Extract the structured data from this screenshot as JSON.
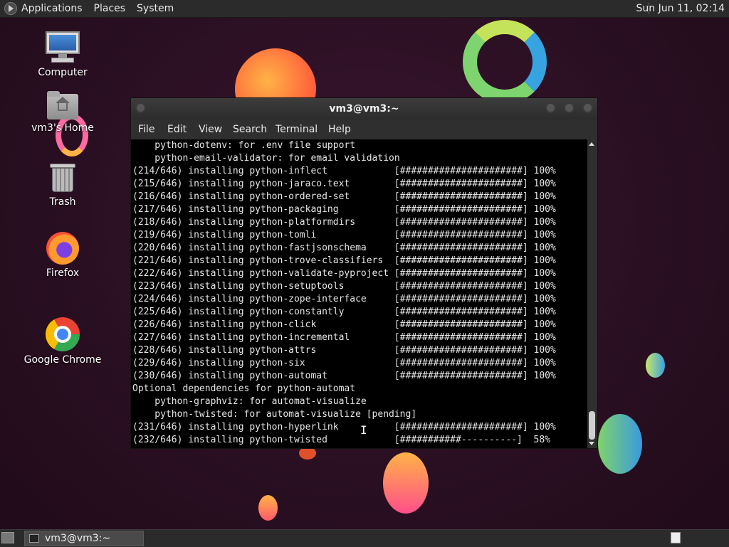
{
  "top_panel": {
    "menus": [
      "Applications",
      "Places",
      "System"
    ],
    "clock": "Sun Jun 11, 02:14"
  },
  "desktop_icons": [
    {
      "label": "Computer",
      "icon": "computer-icon"
    },
    {
      "label": "vm3's Home",
      "icon": "home-folder-icon"
    },
    {
      "label": "Trash",
      "icon": "trash-icon"
    },
    {
      "label": "Firefox",
      "icon": "firefox-icon"
    },
    {
      "label": "Google Chrome",
      "icon": "chrome-icon"
    }
  ],
  "window": {
    "title": "vm3@vm3:~",
    "menus": [
      "File",
      "Edit",
      "View",
      "Search",
      "Terminal",
      "Help"
    ]
  },
  "terminal_lines": [
    "    python-dotenv: for .env file support",
    "    python-email-validator: for email validation",
    "(214/646) installing python-inflect            [######################] 100%",
    "(215/646) installing python-jaraco.text        [######################] 100%",
    "(216/646) installing python-ordered-set        [######################] 100%",
    "(217/646) installing python-packaging          [######################] 100%",
    "(218/646) installing python-platformdirs       [######################] 100%",
    "(219/646) installing python-tomli              [######################] 100%",
    "(220/646) installing python-fastjsonschema     [######################] 100%",
    "(221/646) installing python-trove-classifiers  [######################] 100%",
    "(222/646) installing python-validate-pyproject [######################] 100%",
    "(223/646) installing python-setuptools         [######################] 100%",
    "(224/646) installing python-zope-interface     [######################] 100%",
    "(225/646) installing python-constantly         [######################] 100%",
    "(226/646) installing python-click              [######################] 100%",
    "(227/646) installing python-incremental        [######################] 100%",
    "(228/646) installing python-attrs              [######################] 100%",
    "(229/646) installing python-six                [######################] 100%",
    "(230/646) installing python-automat            [######################] 100%",
    "Optional dependencies for python-automat",
    "    python-graphviz: for automat-visualize",
    "    python-twisted: for automat-visualize [pending]",
    "(231/646) installing python-hyperlink          [######################] 100%",
    "(232/646) installing python-twisted            [###########----------]  58%"
  ],
  "taskbar": {
    "task_label": "vm3@vm3:~"
  },
  "colors": {
    "desktop_bg": "#2a0f22",
    "terminal_bg": "#000000",
    "terminal_fg": "#e6e6e6",
    "panel_bg": "#2b2b2b"
  }
}
